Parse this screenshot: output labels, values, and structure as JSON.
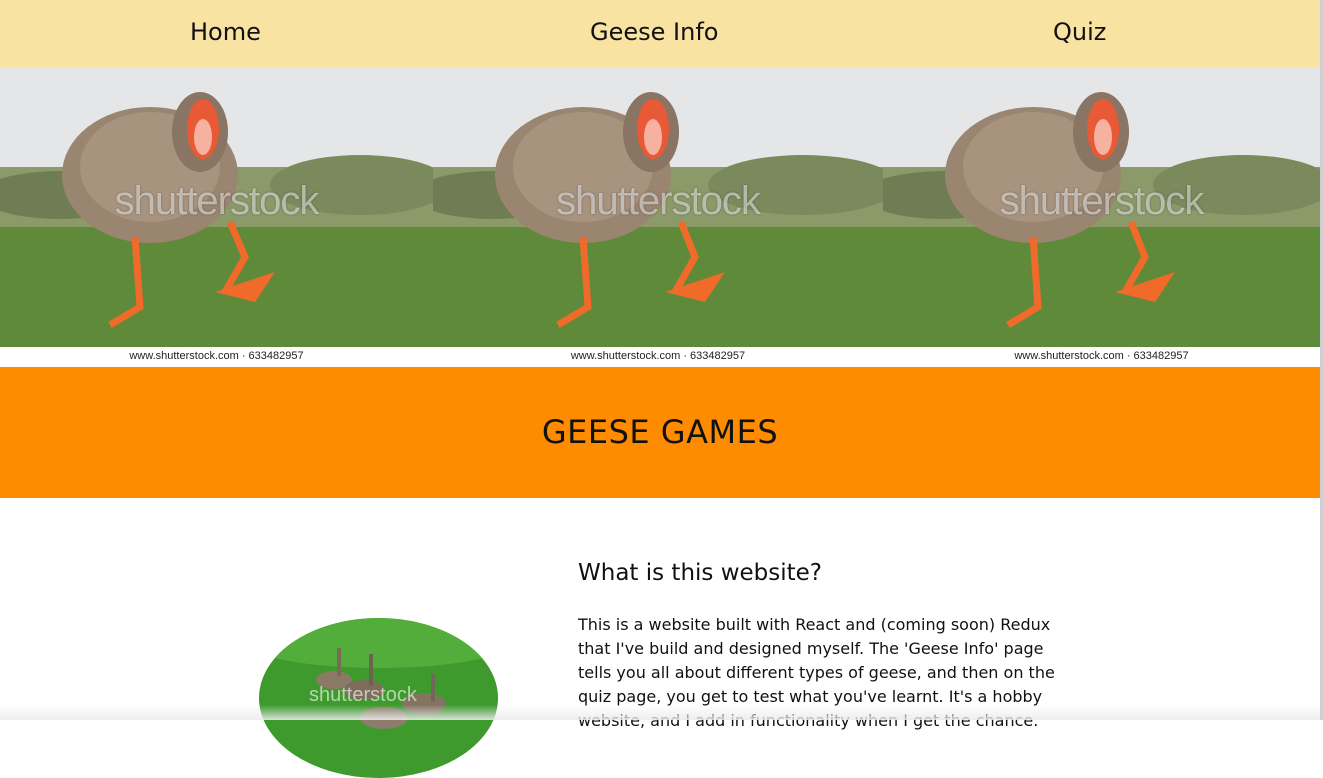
{
  "nav": {
    "home": "Home",
    "geese_info": "Geese Info",
    "quiz": "Quiz"
  },
  "banner": {
    "watermark": "shutterstock",
    "tiles": [
      {
        "credit": "www.shutterstock.com · 633482957"
      },
      {
        "credit": "www.shutterstock.com · 633482957"
      },
      {
        "credit": "www.shutterstock.com · 633482957"
      }
    ]
  },
  "hero": {
    "title": "GEESE GAMES"
  },
  "about": {
    "heading": "What is this website?",
    "body": "This is a website built with React and (coming soon) Redux that I've build and designed myself. The 'Geese Info' page tells you all about different types of geese, and then on the quiz page, you get to test what you've learnt. It's a hobby website, and I add in functionality when I get the chance.",
    "image_watermark": "shutterstock"
  },
  "colors": {
    "nav_bg": "#f9e3a2",
    "hero_bg": "#ff8c00",
    "page_bg": "#ffffff"
  }
}
